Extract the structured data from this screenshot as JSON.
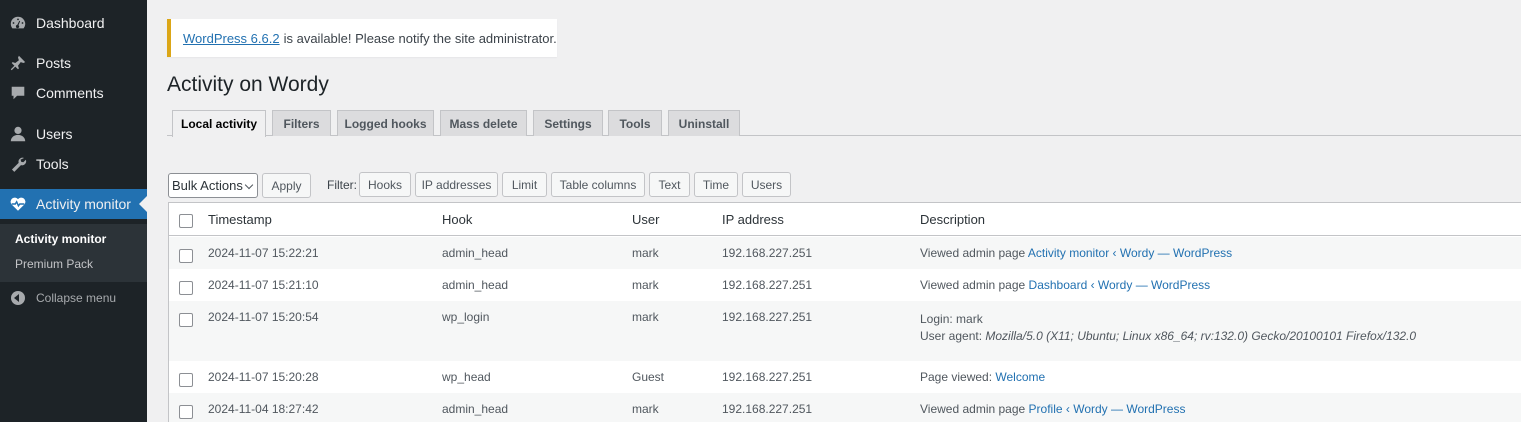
{
  "colors": {
    "sidebar_bg": "#1d2327",
    "accent": "#2271b1",
    "notice_border": "#dba617",
    "link": "#2271b1"
  },
  "sidebar": {
    "items": [
      {
        "label": "Dashboard",
        "icon": "dashboard-icon"
      },
      {
        "label": "Posts",
        "icon": "pin-icon"
      },
      {
        "label": "Comments",
        "icon": "comment-icon"
      },
      {
        "label": "Users",
        "icon": "user-icon"
      },
      {
        "label": "Tools",
        "icon": "wrench-icon"
      },
      {
        "label": "Activity monitor",
        "icon": "heart-pulse-icon",
        "active": true
      }
    ],
    "submenu": [
      "Activity monitor",
      "Premium Pack"
    ],
    "collapse_label": "Collapse menu"
  },
  "notice": {
    "link": "WordPress 6.6.2",
    "text": "is available! Please notify the site administrator."
  },
  "page_title": "Activity on Wordy",
  "tabs": [
    "Local activity",
    "Filters",
    "Logged hooks",
    "Mass delete",
    "Settings",
    "Tools",
    "Uninstall"
  ],
  "toolbar": {
    "bulk_select": "Bulk Actions",
    "apply": "Apply",
    "filter_label": "Filter:",
    "filters": [
      "Hooks",
      "IP addresses",
      "Limit",
      "Table columns",
      "Text",
      "Time",
      "Users"
    ]
  },
  "table": {
    "columns": [
      "Timestamp",
      "Hook",
      "User",
      "IP address",
      "Description"
    ],
    "rows": [
      {
        "timestamp": "2024-11-07 15:22:21",
        "hook": "admin_head",
        "user": "mark",
        "ip": "192.168.227.251",
        "desc_prefix": "Viewed admin page",
        "desc_link": "Activity monitor ‹ Wordy — WordPress"
      },
      {
        "timestamp": "2024-11-07 15:21:10",
        "hook": "admin_head",
        "user": "mark",
        "ip": "192.168.227.251",
        "desc_prefix": "Viewed admin page",
        "desc_link": "Dashboard ‹ Wordy — WordPress"
      },
      {
        "timestamp": "2024-11-07 15:20:54",
        "hook": "wp_login",
        "user": "mark",
        "ip": "192.168.227.251",
        "desc_line1": "Login: mark",
        "desc_agent_label": "User agent:",
        "desc_agent": "Mozilla/5.0 (X11; Ubuntu; Linux x86_64; rv:132.0) Gecko/20100101 Firefox/132.0"
      },
      {
        "timestamp": "2024-11-07 15:20:28",
        "hook": "wp_head",
        "user": "Guest",
        "ip": "192.168.227.251",
        "desc_prefix": "Page viewed:",
        "desc_link": "Welcome"
      },
      {
        "timestamp": "2024-11-04 18:27:42",
        "hook": "admin_head",
        "user": "mark",
        "ip": "192.168.227.251",
        "desc_prefix": "Viewed admin page",
        "desc_link": "Profile ‹ Wordy — WordPress"
      }
    ]
  }
}
